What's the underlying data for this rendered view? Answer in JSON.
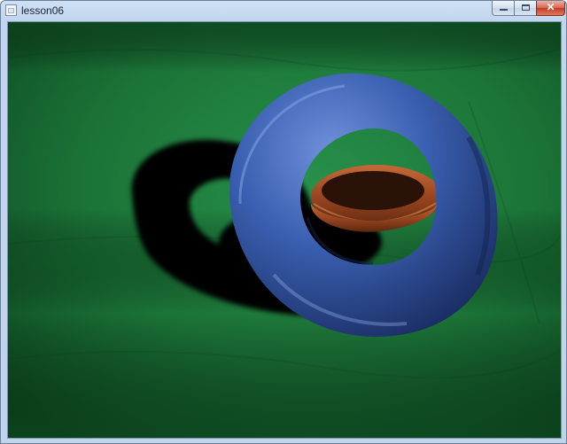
{
  "window": {
    "title": "lesson06",
    "controls": {
      "minimize": "minimize",
      "maximize": "maximize",
      "close_label": "✕"
    }
  },
  "scene": {
    "floor_color": "#1a6b34",
    "outer_torus_color": "#3a5fb0",
    "inner_torus_color": "#a24e24",
    "shadow_color": "#000000"
  }
}
